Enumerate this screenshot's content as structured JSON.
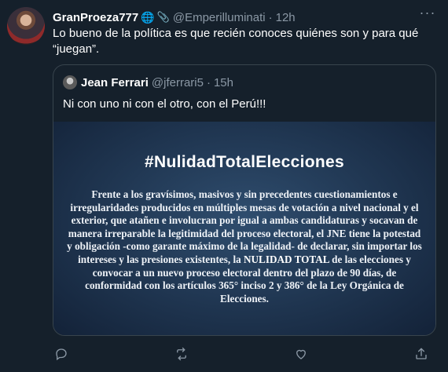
{
  "tweet": {
    "display_name": "GranProeza777",
    "emoji_globe": "🌐",
    "emoji_clip": "📎",
    "handle": "@Emperilluminati",
    "separator": "·",
    "time": "12h",
    "more": "···",
    "text": "Lo bueno de la política es que recién conoces quiénes son y para qué “juegan”."
  },
  "quoted": {
    "display_name": "Jean Ferrari",
    "handle": "@jferrari5",
    "separator": "·",
    "time": "15h",
    "text": "Ni con uno ni con el otro, con el Perú!!!",
    "image": {
      "title": "#NulidadTotalElecciones",
      "body_before": "Frente a los gravísimos, masivos y sin precedentes cuestionamientos e irregularidades producidos en múltiples mesas de votación a nivel nacional y el exterior, que atañen e involucran por igual a ambas candidaturas y socavan de manera irreparable la legitimidad del proceso electoral, el JNE tiene la potestad y obligación -como garante máximo de la legalidad- de declarar, sin importar los intereses y las presiones existentes, la ",
      "body_highlight": "NULIDAD TOTAL",
      "body_after": " de las elecciones y convocar a un nuevo proceso electoral dentro del plazo de 90 días, de conformidad con los artículos 365° inciso 2 y 386° de la Ley Orgánica de Elecciones."
    }
  },
  "actions": [
    "reply-icon",
    "retweet-icon",
    "like-icon",
    "share-icon"
  ],
  "colors": {
    "background": "#15202b",
    "secondary_text": "#8b98a5",
    "border": "#38444d"
  }
}
